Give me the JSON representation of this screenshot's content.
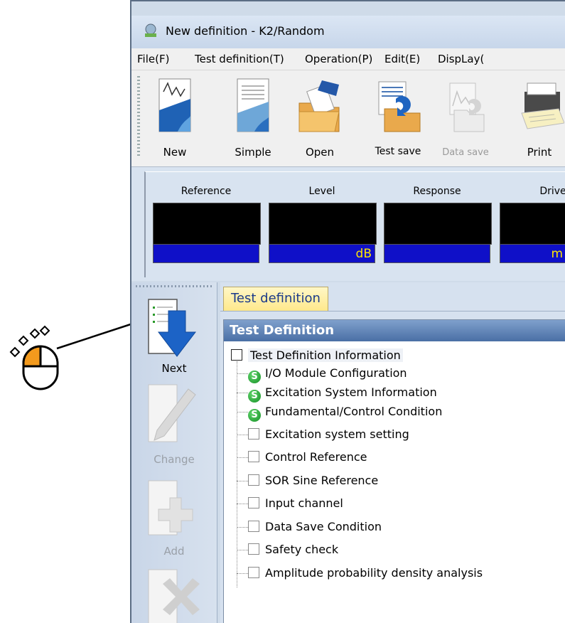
{
  "window": {
    "title": "New definition - K2/Random"
  },
  "menu": [
    "File(F)",
    "Test definition(T)",
    "Operation(P)",
    "Edit(E)",
    "DispLay("
  ],
  "toolbar": {
    "new": "New",
    "simple": "Simple",
    "open": "Open",
    "test_save": "Test save",
    "data_save": "Data save",
    "print": "Print"
  },
  "meters": [
    {
      "label": "Reference",
      "unit": ""
    },
    {
      "label": "Level",
      "unit": "dB"
    },
    {
      "label": "Response",
      "unit": ""
    },
    {
      "label": "Drive",
      "unit": "m"
    }
  ],
  "sidebar": {
    "next": "Next",
    "change": "Change",
    "add": "Add"
  },
  "tab": "Test definition",
  "panel": {
    "header": "Test Definition",
    "root": "Test Definition Information",
    "items": [
      "I/O Module Configuration",
      "Excitation System Information",
      "Fundamental/Control Condition",
      "Excitation system setting",
      "Control Reference",
      "SOR Sine Reference",
      "Input channel",
      "Data Save Condition",
      "Safety check",
      "Amplitude probability density analysis"
    ],
    "s_badge": "S"
  },
  "colors": {
    "meter_blue": "#0f10c8",
    "meter_text": "#ffe600",
    "header_blue": "#4a6fa5"
  }
}
